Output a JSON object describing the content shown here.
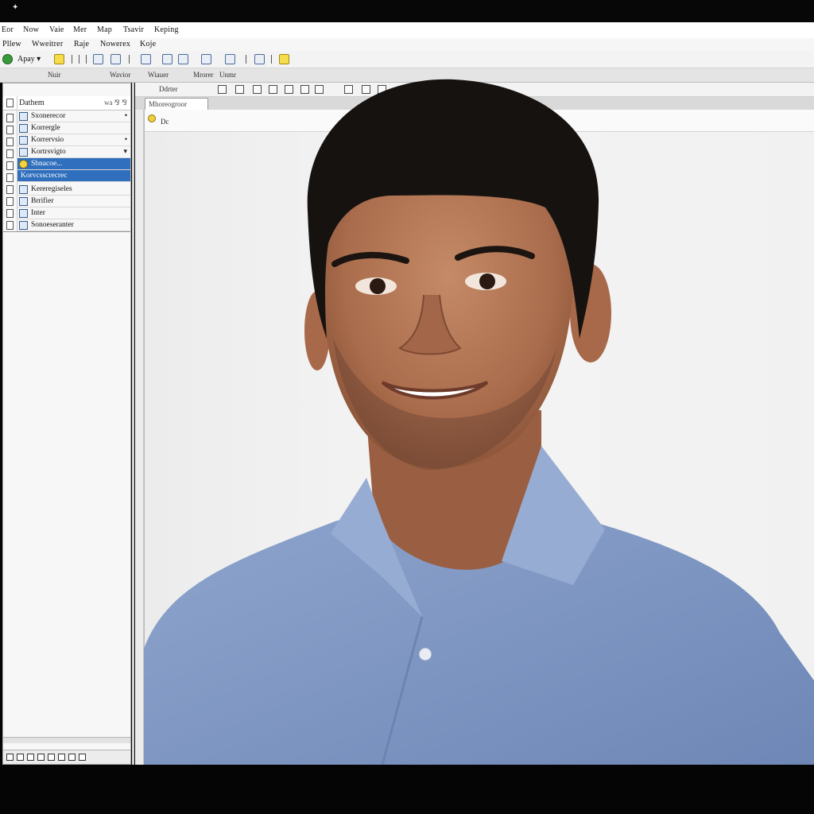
{
  "titlebar": {
    "glyph": "✦"
  },
  "menubar": {
    "items": [
      "Eor",
      "Now",
      "Vaie",
      "Mer",
      "Map",
      "Tsavir",
      "Keping"
    ]
  },
  "menubar2": {
    "items": [
      "Pllew",
      "Wweitrer",
      "Raje",
      "Nowerex",
      "Koje"
    ]
  },
  "toolbar": {
    "apply_label": "Apay ▾"
  },
  "column_headers": [
    "Nuir",
    "Wavior",
    "Wiauer",
    "Mrorer",
    "Unmr"
  ],
  "left_panel": {
    "header": "Dathem",
    "header_right": "wa ⅋ ⅋",
    "items": [
      {
        "label": "Sxonerecor",
        "dot": "•"
      },
      {
        "label": "Korrergle",
        "dot": ""
      },
      {
        "label": "Korrervsio",
        "dot": "•"
      },
      {
        "label": "Kortrsvigto",
        "dot": "▾"
      },
      {
        "label": "Sbnacoe...",
        "dot": ""
      },
      {
        "label": "Korvcsscrecrec",
        "dot": ""
      },
      {
        "label": "Kereregiseles",
        "dot": ""
      },
      {
        "label": "Brrifier",
        "dot": ""
      },
      {
        "label": "Inter",
        "dot": ""
      },
      {
        "label": "Sonoeseranter",
        "dot": ""
      }
    ],
    "selected_index": 4
  },
  "right": {
    "tab_label": "Mhoreogroor",
    "first_row_label": "Dc",
    "toolbar_label": "Ddrter"
  },
  "colors": {
    "selection": "#2f6fbd",
    "shirt": "#7f97c2",
    "hair": "#151210",
    "skin": "#b07453"
  }
}
